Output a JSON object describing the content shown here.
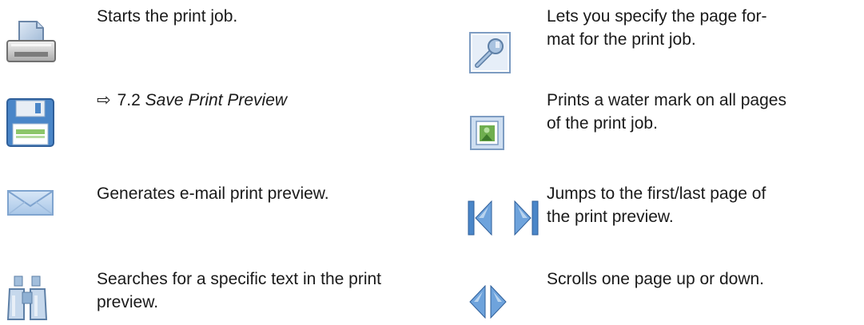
{
  "left_column": [
    {
      "icon": "printer-icon",
      "description": "Starts the print job."
    },
    {
      "icon": "floppy-disk-icon",
      "reference_arrow": "⇨",
      "reference_number": "7.2",
      "reference_title": "Save Print Preview"
    },
    {
      "icon": "envelope-icon",
      "description": "Generates e-mail print preview."
    },
    {
      "icon": "binoculars-icon",
      "description_line1": "Searches for a specific text in the print",
      "description_line2": "preview."
    }
  ],
  "right_column": [
    {
      "icon": "wrench-icon",
      "description_line1": "Lets you specify the page for-",
      "description_line2": "mat for the print job."
    },
    {
      "icon": "watermark-icon",
      "description_line1": "Prints a water mark on all pages",
      "description_line2": "of the print job."
    },
    {
      "icon": "first-last-page-icon",
      "description_line1": "Jumps to the first/last page of",
      "description_line2": "the print preview."
    },
    {
      "icon": "scroll-arrows-icon",
      "description": "Scrolls one page up or down."
    }
  ],
  "colors": {
    "icon_blue": "#4a86c8",
    "icon_light": "#b9d4ef",
    "floppy_green": "#8cc56a"
  }
}
